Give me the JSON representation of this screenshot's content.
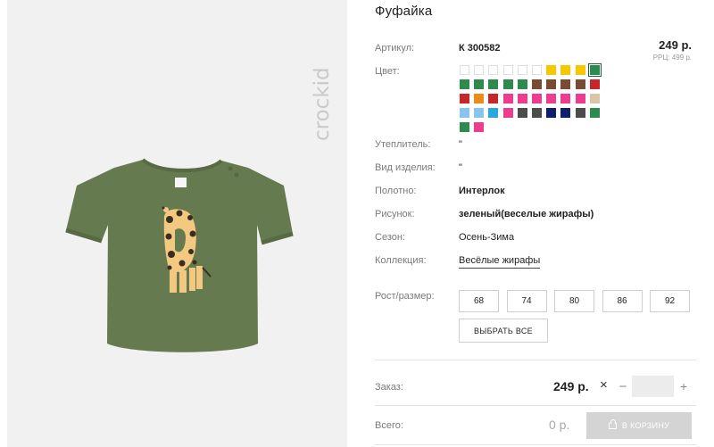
{
  "gallery": {
    "brand": "crockid",
    "product_image_alt": "Фуфайка зеленая с жирафом"
  },
  "product": {
    "title": "Фуфайка",
    "article_label": "Артикул:",
    "article_value": "К 300582",
    "price": "249 р.",
    "rrp": "РРЦ: 499 р."
  },
  "colors": {
    "label": "Цвет:",
    "rows": [
      [
        "#ffffff",
        "#ffffff",
        "#ffffff",
        "#ffffff",
        "#ffffff",
        "#ffffff",
        "#f7c800",
        "#f7c800",
        "#f7c800",
        "#2e8b4f"
      ],
      [
        "#2e8b4f",
        "#2e8b4f",
        "#2e8b4f",
        "#2e8b4f",
        "#2e8b4f",
        "#7a4a32",
        "#7a4a32",
        "#7a4a32",
        "#7a4a32",
        "#c8272a"
      ],
      [
        "#c8272a",
        "#f08a17",
        "#c8272a",
        "#ee3d8f",
        "#ee3d8f",
        "#ee3d8f",
        "#ee3d8f",
        "#ee3d8f",
        "#ee3d8f",
        "#d8c6a6"
      ],
      [
        "#86c5f0",
        "#86c5f0",
        "#2aa7df",
        "#ee3d8f",
        "#4c4c4c",
        "#4c4c4c",
        "#0f1f6e",
        "#0f1f6e",
        "#4c4c4c",
        "#2e8b4f"
      ],
      [
        "#2e8b4f",
        "#ee3d8f"
      ]
    ],
    "selected_row": 0,
    "selected_index": 9
  },
  "attributes": [
    {
      "label": "Утеплитель:",
      "value": "\"",
      "bold": false
    },
    {
      "label": "Вид изделия:",
      "value": "\"",
      "bold": false
    },
    {
      "label": "Полотно:",
      "value": "Интерлок",
      "bold": true
    },
    {
      "label": "Рисунок:",
      "value": "зеленый(веселые жирафы)",
      "bold": true
    },
    {
      "label": "Сезон:",
      "value": "Осень-Зима",
      "bold": false
    }
  ],
  "collection": {
    "label": "Коллекция:",
    "value": "Весёлые жирафы"
  },
  "sizes": {
    "label": "Рост/размер:",
    "options": [
      "68",
      "74",
      "80",
      "86",
      "92"
    ],
    "select_all": "ВЫБРАТЬ ВСЕ"
  },
  "order": {
    "label": "Заказ:",
    "price": "249 р.",
    "times": "×",
    "minus": "−",
    "plus": "+",
    "quantity": ""
  },
  "total": {
    "label": "Всего:",
    "value": "0 р.",
    "cart_button": "В КОРЗИНУ"
  }
}
